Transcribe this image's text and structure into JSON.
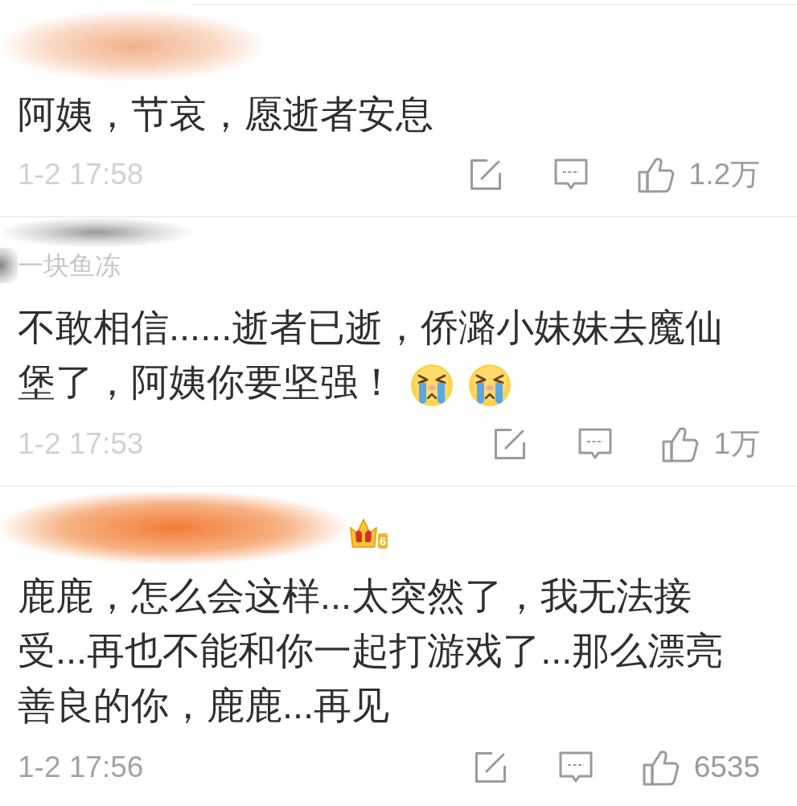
{
  "comments": [
    {
      "author": {
        "smudge": {
          "kind": "peach"
        }
      },
      "text": "阿姨，节哀，愿逝者安息",
      "time": {
        "text": "1-2 17:58",
        "faded": true
      },
      "likes": "1.2万"
    },
    {
      "author": {
        "name": "一块鱼冻",
        "smudge": {
          "kind": "grey"
        }
      },
      "lines": [
        "不敢相信......逝者已逝，侨潞小妹妹去魔仙",
        "堡了，阿姨你要坚强！"
      ],
      "emojis": [
        {
          "kind": "crying"
        },
        {
          "kind": "crying"
        }
      ],
      "time": {
        "text": "1-2 17:53",
        "faded": true
      },
      "likes": "1万"
    },
    {
      "author": {
        "smudge": {
          "kind": "orange"
        },
        "badge": {
          "kind": "crown",
          "label": "6"
        }
      },
      "text": "鹿鹿，怎么会这样...太突然了，我无法接受...再也不能和你一起打游戏了...那么漂亮善良的你，鹿鹿...再见",
      "time": {
        "text": "1-2 17:56",
        "faded": false
      },
      "likes": "6535"
    }
  ]
}
